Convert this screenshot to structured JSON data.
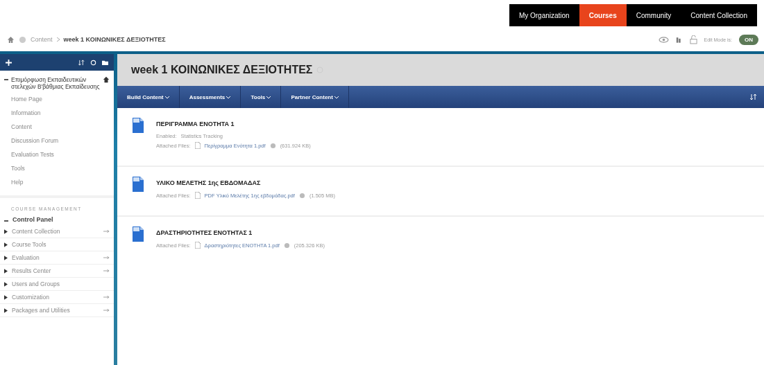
{
  "top_tabs": [
    {
      "label": "My Organization",
      "selected": false
    },
    {
      "label": "Courses",
      "selected": true
    },
    {
      "label": "Community",
      "selected": false
    },
    {
      "label": "Content Collection",
      "selected": false
    }
  ],
  "breadcrumb": {
    "items": [
      "Content",
      "week 1 ΚΟΙΝΩΝΙΚΕΣ ΔΕΞΙΟΤΗΤΕΣ"
    ]
  },
  "edit_mode": {
    "label": "Edit Mode is:",
    "state": "ON",
    "on": true
  },
  "sidebar": {
    "course_title": "Επιμόρφωση Εκπαιδευτικών στελεχών Β'βάθμιας Εκπαίδευσης",
    "items": [
      "Home Page",
      "Information",
      "Content",
      "Discussion Forum",
      "Evaluation Tests",
      "Tools",
      "Help"
    ],
    "management_heading": "COURSE MANAGEMENT",
    "control_panel": {
      "label": "Control Panel",
      "expanded": true,
      "items": [
        {
          "label": "Content Collection",
          "flyout": true
        },
        {
          "label": "Course Tools",
          "flyout": false
        },
        {
          "label": "Evaluation",
          "flyout": true
        },
        {
          "label": "Results Center",
          "flyout": true
        },
        {
          "label": "Users and Groups",
          "flyout": false
        },
        {
          "label": "Customization",
          "flyout": true
        },
        {
          "label": "Packages and Utilities",
          "flyout": true
        }
      ]
    }
  },
  "page_title": "week 1 ΚΟΙΝΩΝΙΚΕΣ ΔΕΞΙΟΤΗΤΕΣ",
  "action_bar": [
    "Build Content",
    "Assessments",
    "Tools",
    "Partner Content"
  ],
  "content_items": [
    {
      "title": "ΠΕΡΙΓΡΑΜΜΑ ΕΝΟΤΗΤΑ 1",
      "enabled_label": "Enabled:",
      "enabled_value": "Statistics Tracking",
      "files_label": "Attached Files:",
      "file": "Περίγραμμα Ενότητα 1.pdf",
      "size": "(631.924 KB)"
    },
    {
      "title": "ΥΛΙΚΟ ΜΕΛΕΤΗΣ 1ης ΕΒΔΟΜΑΔΑΣ",
      "files_label": "Attached Files:",
      "file": "PDF Υλικό Μελέτης 1ης εβδομάδας.pdf",
      "size": "(1.505 MB)"
    },
    {
      "title": "ΔΡΑΣΤΗΡΙΟΤΗΤΕΣ ΕΝΟΤΗΤΑΣ 1",
      "files_label": "Attached Files:",
      "file": "Δραστηριότητες ΕΝΟΤΗΤΑ 1.pdf",
      "size": "(205.326 KB)"
    }
  ]
}
